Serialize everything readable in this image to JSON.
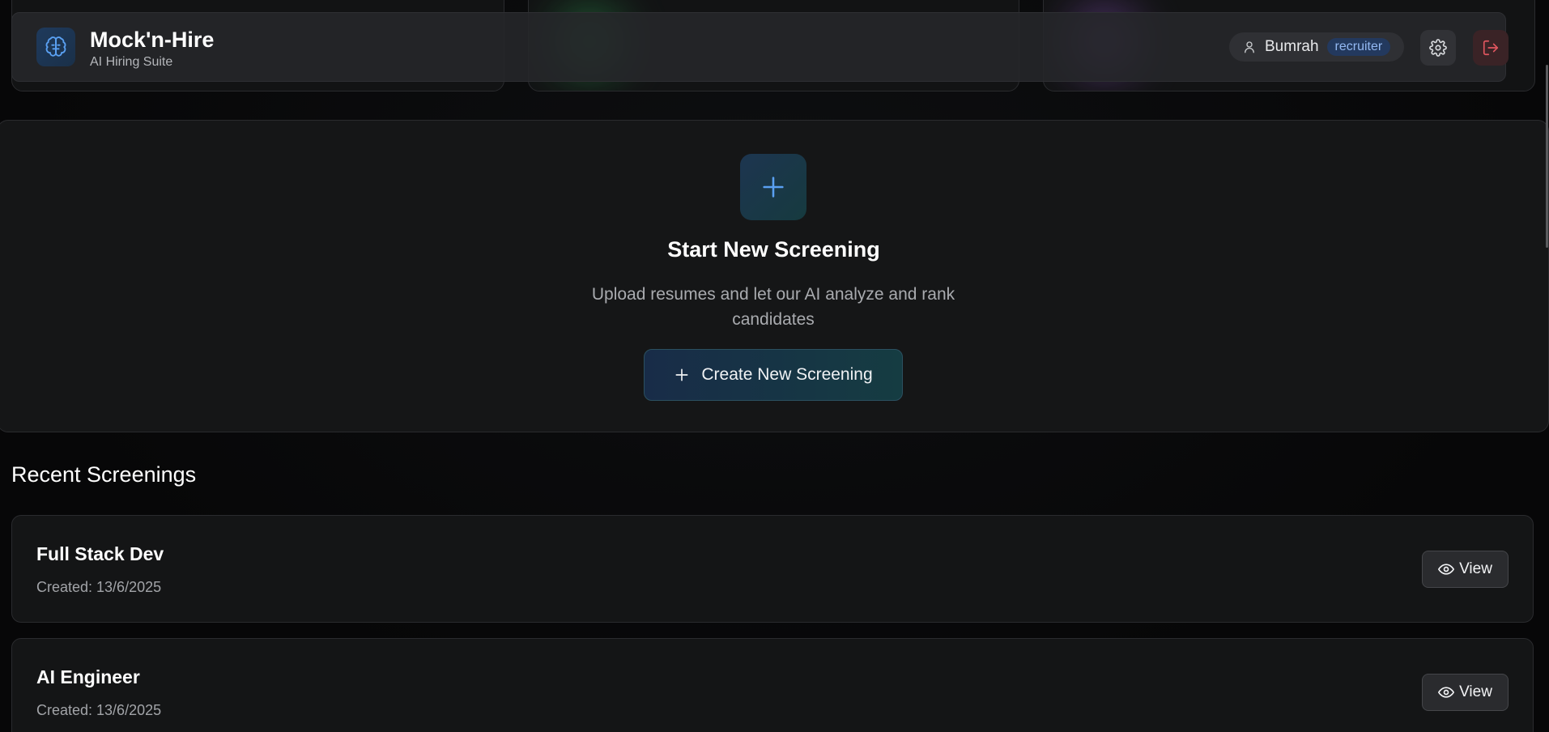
{
  "header": {
    "app_title": "Mock'n-Hire",
    "app_subtitle": "AI Hiring Suite",
    "user_name": "Bumrah",
    "user_role": "recruiter",
    "logo_icon": "brain-icon",
    "settings_icon": "gear-icon",
    "logout_icon": "logout-icon"
  },
  "hero": {
    "title": "Start New Screening",
    "description": "Upload resumes and let our AI analyze and rank candidates",
    "button_label": "Create New Screening",
    "icon": "plus-icon"
  },
  "recent": {
    "title": "Recent Screenings",
    "view_label": "View",
    "items": [
      {
        "name": "Full Stack Dev",
        "created": "Created: 13/6/2025"
      },
      {
        "name": "AI Engineer",
        "created": "Created: 13/6/2025"
      }
    ]
  },
  "colors": {
    "accent_blue": "#5aa0f2",
    "logout_red": "#e0565f",
    "badge_text": "#93b8f2",
    "background": "#08090a"
  }
}
